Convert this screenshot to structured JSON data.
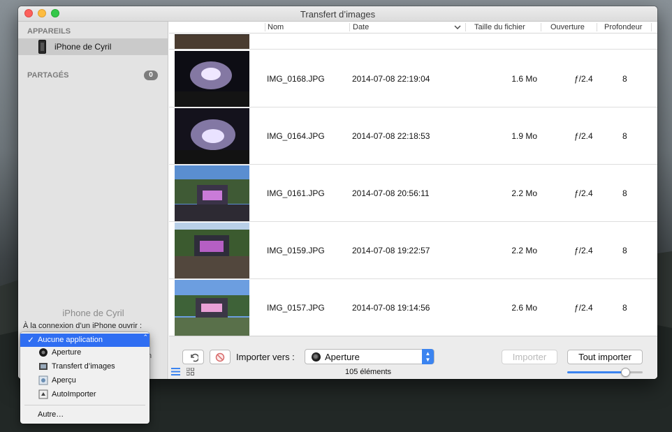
{
  "window": {
    "title": "Transfert d’images"
  },
  "sidebar": {
    "devices_header": "APPAREILS",
    "device_name": "iPhone de Cyril",
    "shared_header": "PARTAGÉS",
    "shared_count": "0",
    "footer_device_name": "iPhone de Cyril",
    "connect_label": "À la connexion d’un iPhone ouvrir :",
    "after_select_fragment": "n"
  },
  "table": {
    "columns": [
      "Nom",
      "Date",
      "Taille du fichier",
      "Ouverture",
      "Profondeur"
    ],
    "rows": [
      {
        "name": "IMG_0168.JPG",
        "date": "2014-07-08 22:19:04",
        "size": "1.6 Mo",
        "aperture": "ƒ/2.4",
        "depth": "8",
        "thumb": "night-stage"
      },
      {
        "name": "IMG_0164.JPG",
        "date": "2014-07-08 22:18:53",
        "size": "1.9 Mo",
        "aperture": "ƒ/2.4",
        "depth": "8",
        "thumb": "night-stage"
      },
      {
        "name": "IMG_0161.JPG",
        "date": "2014-07-08 20:56:11",
        "size": "2.2 Mo",
        "aperture": "ƒ/2.4",
        "depth": "8",
        "thumb": "dusk-stage"
      },
      {
        "name": "IMG_0159.JPG",
        "date": "2014-07-08 19:22:57",
        "size": "2.2 Mo",
        "aperture": "ƒ/2.4",
        "depth": "8",
        "thumb": "day-stage"
      },
      {
        "name": "IMG_0157.JPG",
        "date": "2014-07-08 19:14:56",
        "size": "2.6 Mo",
        "aperture": "ƒ/2.4",
        "depth": "8",
        "thumb": "day-stage"
      }
    ]
  },
  "toolbar": {
    "import_to_label": "Importer vers :",
    "import_to_value": "Aperture",
    "import_button": "Importer",
    "import_all_button": "Tout importer",
    "item_count": "105 éléments",
    "thumbnail_size": 0.77
  },
  "dropdown": {
    "items": [
      {
        "label": "Aucune application",
        "icon": "none",
        "selected": true
      },
      {
        "label": "Aperture",
        "icon": "aperture-icon"
      },
      {
        "label": "Transfert d’images",
        "icon": "image-capture-icon"
      },
      {
        "label": "Aperçu",
        "icon": "preview-icon"
      },
      {
        "label": "AutoImporter",
        "icon": "autoimporter-icon"
      }
    ],
    "other": "Autre…"
  },
  "colors": {
    "accent": "#2f6ef2",
    "close": "#fc605c",
    "minimize": "#fdbc40",
    "maximize": "#34c84a"
  }
}
